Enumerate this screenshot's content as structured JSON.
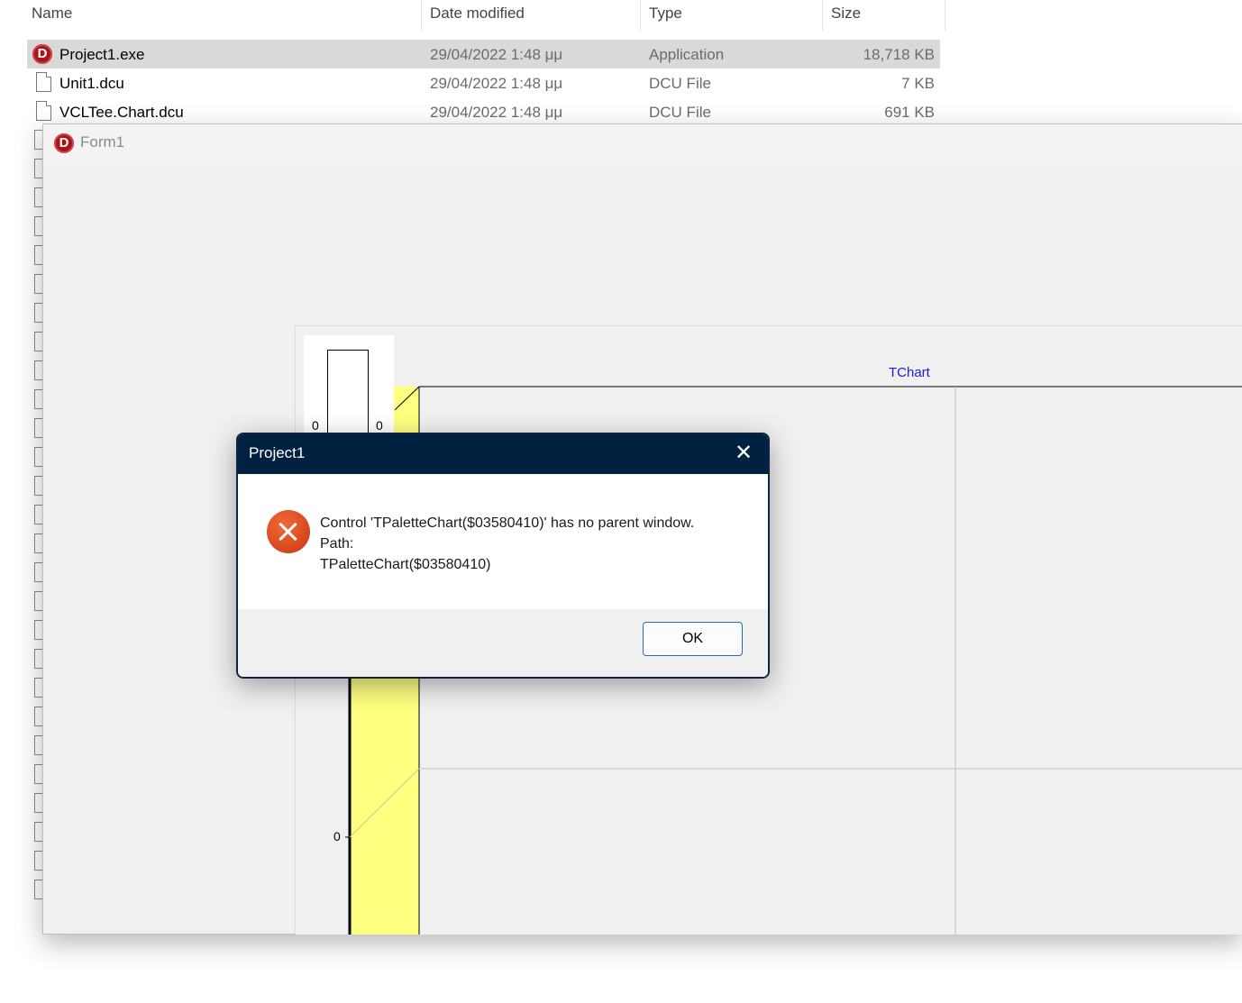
{
  "explorer": {
    "columns": {
      "name": "Name",
      "date": "Date modified",
      "type": "Type",
      "size": "Size"
    },
    "files": [
      {
        "name": "Project1.exe",
        "date": "29/04/2022 1:48 μμ",
        "type": "Application",
        "size": "18,718 KB",
        "icon": "delphi-app-icon",
        "selected": true
      },
      {
        "name": "Unit1.dcu",
        "date": "29/04/2022 1:48 μμ",
        "type": "DCU File",
        "size": "7 KB",
        "icon": "file-icon",
        "selected": false
      },
      {
        "name": "VCLTee.Chart.dcu",
        "date": "29/04/2022 1:48 μμ",
        "type": "DCU File",
        "size": "691 KB",
        "icon": "file-icon",
        "selected": false
      }
    ]
  },
  "form1": {
    "title": "Form1",
    "icon": "delphi-app-icon",
    "chart": {
      "title": "TChart",
      "palette_labels": [
        "0",
        "0"
      ],
      "axis_label": "0",
      "colors": {
        "wall": "#ffff80",
        "title": "#1a1adb"
      }
    }
  },
  "dialog": {
    "title": "Project1",
    "close_label": "✕",
    "icon": "error-icon",
    "message_lines": [
      "Control 'TPaletteChart($03580410)' has no parent window.",
      "Path:",
      "TPaletteChart($03580410)"
    ],
    "ok_label": "OK"
  }
}
